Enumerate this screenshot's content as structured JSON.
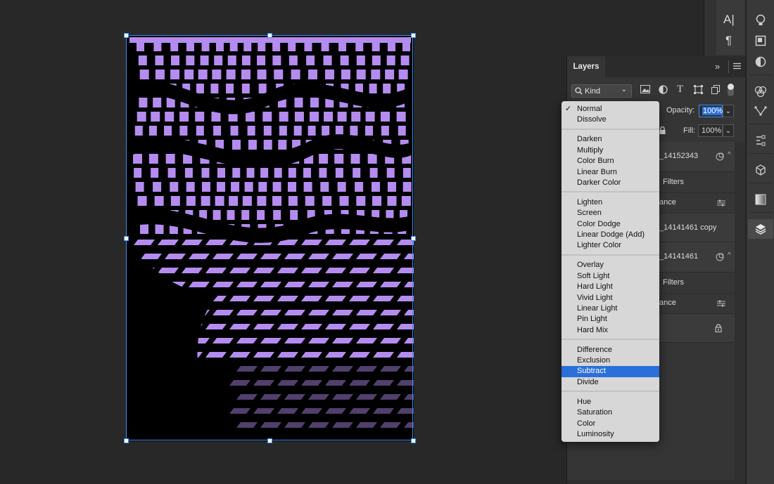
{
  "layers_panel": {
    "tab_label": "Layers",
    "kind_label": "Kind",
    "opacity_label": "Opacity:",
    "opacity_value": "100%",
    "fill_label": "Fill:",
    "fill_value": "100%",
    "layers": [
      {
        "name": "_14152343"
      },
      {
        "name": "Filters"
      },
      {
        "name": "ance"
      },
      {
        "name": "_14141461 copy"
      },
      {
        "name": "_14141461"
      },
      {
        "name": "Filters"
      },
      {
        "name": "ance"
      }
    ]
  },
  "blend_menu": {
    "groups": [
      [
        "Normal",
        "Dissolve"
      ],
      [
        "Darken",
        "Multiply",
        "Color Burn",
        "Linear Burn",
        "Darker Color"
      ],
      [
        "Lighten",
        "Screen",
        "Color Dodge",
        "Linear Dodge (Add)",
        "Lighter Color"
      ],
      [
        "Overlay",
        "Soft Light",
        "Hard Light",
        "Vivid Light",
        "Linear Light",
        "Pin Light",
        "Hard Mix"
      ],
      [
        "Difference",
        "Exclusion",
        "Subtract",
        "Divide"
      ],
      [
        "Hue",
        "Saturation",
        "Color",
        "Luminosity"
      ]
    ],
    "checked": "Normal",
    "highlighted": "Subtract"
  },
  "colors": {
    "accent": "#2a6fdb",
    "selection_border": "#3a8ef0",
    "artwork_purple": "#b48cf0"
  },
  "icons": {
    "character_panel": "A|",
    "paragraph_panel": "¶"
  }
}
